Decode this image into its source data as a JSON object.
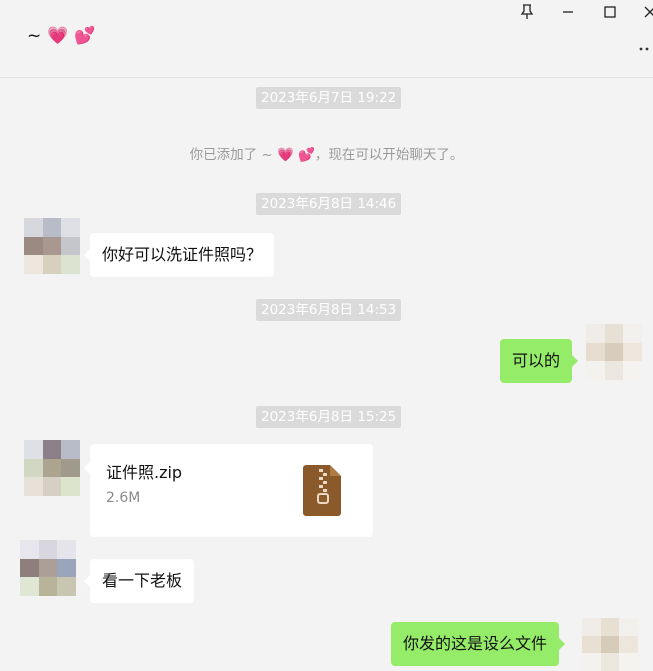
{
  "window": {
    "title_prefix": "~",
    "title_emoji_1": "💗",
    "title_emoji_2": "💕",
    "pin_icon": "📌",
    "minimize": "—",
    "maximize": "☐",
    "close": "✕",
    "more": "··"
  },
  "messages": {
    "ts1": "2023年6月7日 19:22",
    "sys_before": "你已添加了 ~ ",
    "sys_emoji": "💗",
    "sys_emoji2": "💕",
    "sys_after": "，现在可以开始聊天了。",
    "ts2": "2023年6月8日 14:46",
    "msg1": "你好可以洗证件照吗？",
    "ts3": "2023年6月8日 14:53",
    "msg2": "可以的",
    "ts4": "2023年6月8日 15:25",
    "file_name": "证件照.zip",
    "file_size": "2.6M",
    "msg3": "看一下老板",
    "msg4": "你发的这是设么文件"
  },
  "colors": {
    "own_bubble": "#95ec69",
    "other_bubble": "#ffffff",
    "background": "#f3f3f3",
    "zip_icon": "#8b5a2b"
  }
}
